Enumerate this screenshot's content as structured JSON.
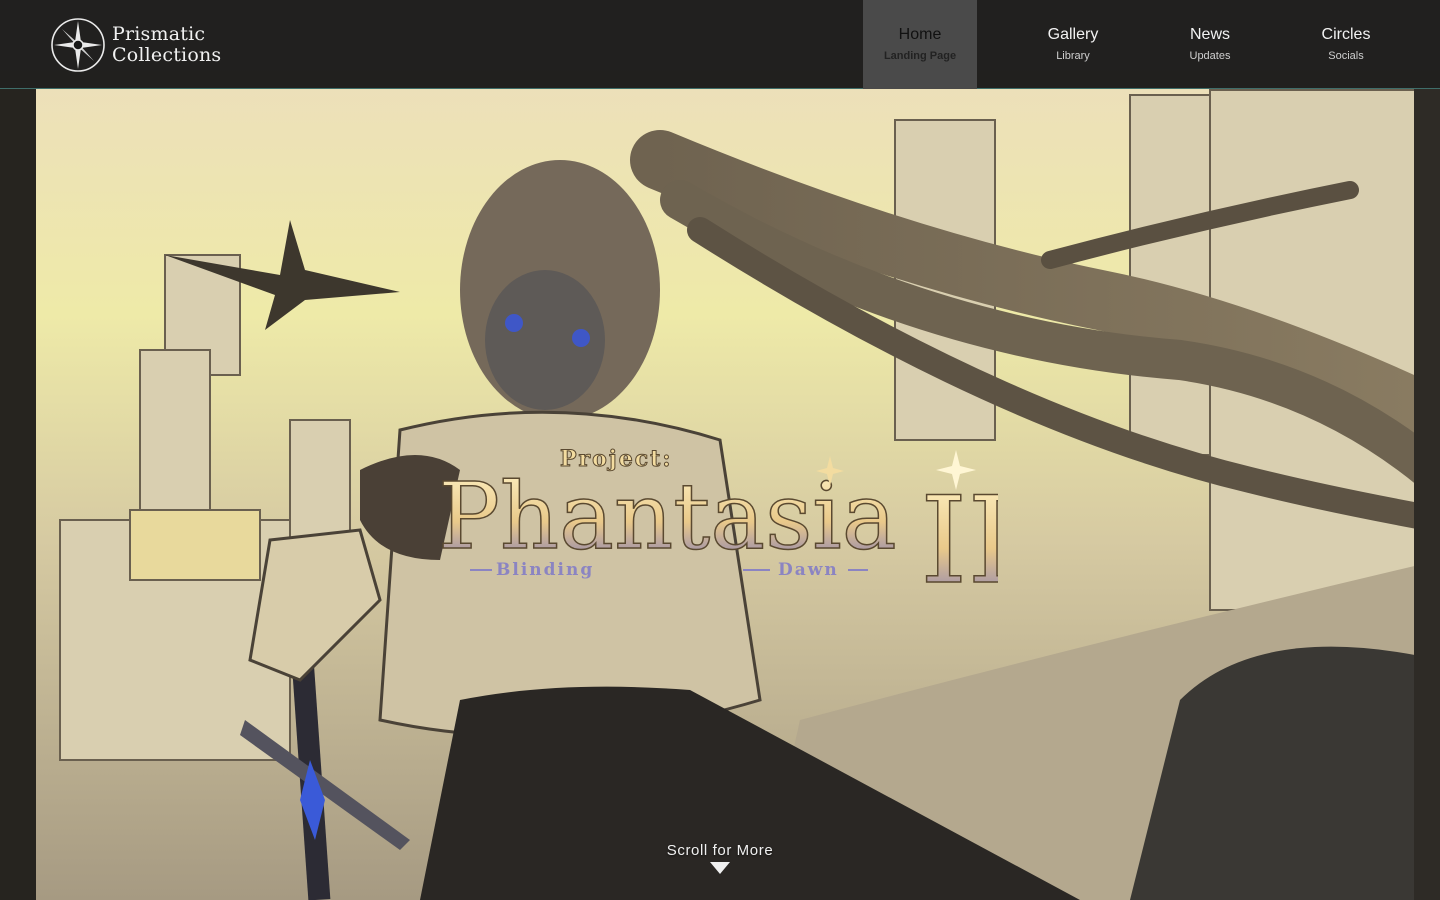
{
  "brand": {
    "line1": "Prismatic",
    "line2": "Collections",
    "logo_icon": "compass-star-icon"
  },
  "nav": {
    "items": [
      {
        "label": "Home",
        "sub": "Landing Page",
        "active": true
      },
      {
        "label": "Gallery",
        "sub": "Library",
        "active": false
      },
      {
        "label": "News",
        "sub": "Updates",
        "active": false
      },
      {
        "label": "Circles",
        "sub": "Socials",
        "active": false
      }
    ]
  },
  "hero": {
    "title_top": "Project:",
    "title_main": "Phantasia",
    "title_numeral": "II",
    "subtitle_left": "Blinding",
    "subtitle_right": "Dawn",
    "scroll_text": "Scroll for More",
    "scroll_icon": "triangle-down-icon"
  },
  "colors": {
    "nav_bg": "#181818",
    "nav_active_bg": "#4a4a4a",
    "nav_border": "#3f6e6a",
    "title_gold": "#f3dca0",
    "title_violet": "#7d78b8"
  }
}
